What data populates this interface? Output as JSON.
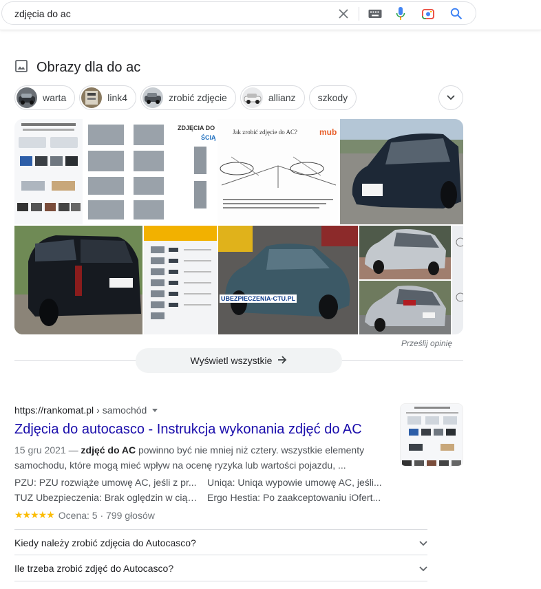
{
  "search": {
    "query": "zdjęcia do ac"
  },
  "images": {
    "heading": "Obrazy dla do ac",
    "chips": [
      {
        "label": "warta"
      },
      {
        "label": "link4"
      },
      {
        "label": "zrobić zdjęcie"
      },
      {
        "label": "allianz"
      },
      {
        "label": "szkody"
      }
    ],
    "tile_texts": {
      "t2_heading": "ZDJĘCIA DO PA",
      "t2_sub": "ŚCIĄG",
      "t3_heading": "Jak zrobić zdjęcie do AC?",
      "t3_brand": "mub",
      "t8_watermark": "UBEZPIECZENIA-CTU.PL"
    },
    "feedback": "Prześlij opinię",
    "show_all": "Wyświetl wszystkie"
  },
  "result": {
    "domain": "https://rankomat.pl",
    "path": "› samochód",
    "title": "Zdjęcia do autocasco - Instrukcja wykonania zdjęć do AC",
    "date": "15 gru 2021",
    "dash": " — ",
    "bold_term": "zdjęć do AC",
    "snippet_rest": " powinno być nie mniej niż cztery. wszystkie elementy samochodu, które mogą mieć wpływ na ocenę ryzyka lub wartości pojazdu, ...",
    "sitelinks": [
      {
        "key": "PZU:",
        "text": "PZU rozwiąże umowę AC, jeśli z pr..."
      },
      {
        "key": "Uniqa:",
        "text": "Uniqa wypowie umowę AC, jeśli..."
      },
      {
        "key": "TUZ Ubezpieczenia:",
        "text": "Brak oględzin w ciąg..."
      },
      {
        "key": "Ergo Hestia:",
        "text": "Po zaakceptowaniu iOfert..."
      }
    ],
    "rating_stars": "★★★★★",
    "rating_text": "Ocena: 5 · 799 głosów"
  },
  "faq": [
    {
      "question": "Kiedy należy zrobić zdjęcia do Autocasco?"
    },
    {
      "question": "Ile trzeba zrobić zdjęć do Autocasco?"
    }
  ],
  "colors": {
    "link": "#1a0dab",
    "mic_blue": "#4285f4",
    "star": "#fbbc04"
  }
}
